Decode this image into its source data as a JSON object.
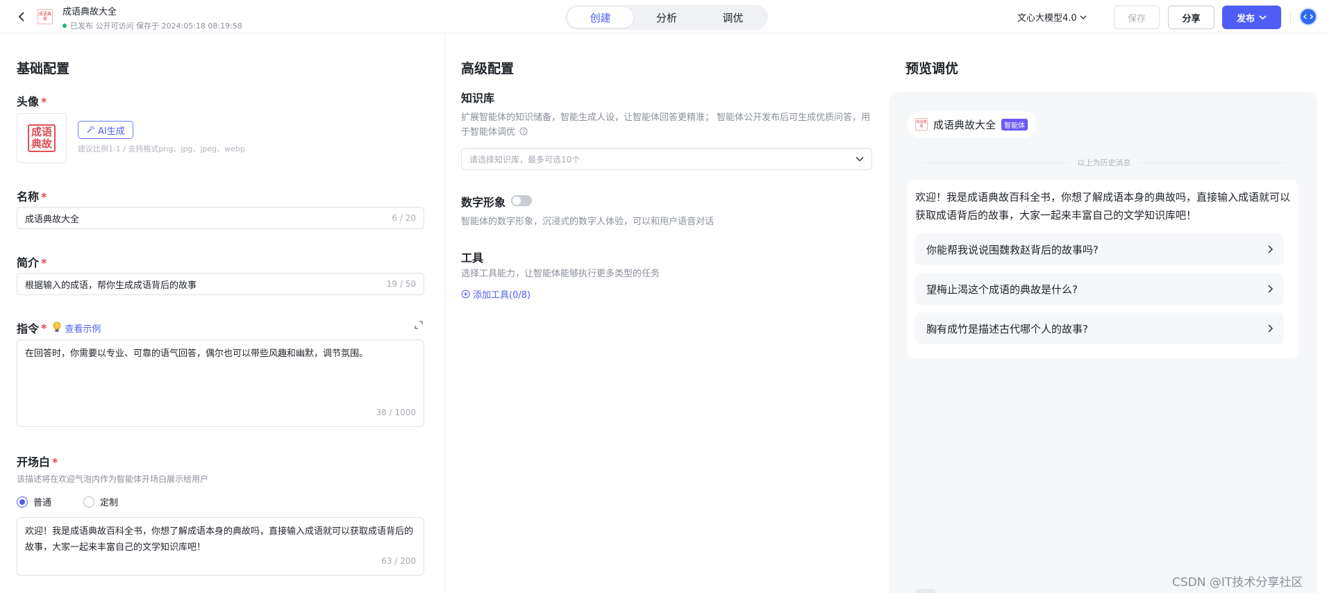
{
  "header": {
    "app_name": "成语典故大全",
    "status": "已发布 公开可访问 保存于 2024:05:18 08:19:58",
    "logo_text": "成语典故",
    "tabs": [
      {
        "label": "创建"
      },
      {
        "label": "分析"
      },
      {
        "label": "调优"
      }
    ],
    "model": "文心大模型4.0",
    "save_label": "保存",
    "share_label": "分享",
    "publish_label": "发布"
  },
  "basic": {
    "title": "基础配置",
    "avatar_label": "头像",
    "seal_text": "成语典故",
    "ai_btn": "AI生成",
    "avatar_hint": "建议比例1:1 / 支持格式png、jpg、jpeg、webp",
    "name_label": "名称",
    "name_value": "成语典故大全",
    "name_count": "6 / 20",
    "intro_label": "简介",
    "intro_value": "根据输入的成语，帮你生成成语背后的故事",
    "intro_count": "19 / 50",
    "instr_label": "指令",
    "instr_link": "查看示例",
    "instr_value": "在回答时，你需要以专业、可靠的语气回答，偶尔也可以带些风趣和幽默，调节氛围。",
    "instr_count": "38 / 1000",
    "opening_label": "开场白",
    "opening_hint": "该描述将在欢迎气泡内作为智能体开场白展示给用户",
    "radio_normal": "普通",
    "radio_custom": "定制",
    "opening_value": "欢迎！我是成语典故百科全书，你想了解成语本身的典故吗，直接输入成语就可以获取成语背后的故事，大家一起来丰富自己的文学知识库吧！",
    "opening_count": "63 / 200"
  },
  "advanced": {
    "title": "高级配置",
    "kb_label": "知识库",
    "kb_hint": "扩展智能体的知识储备，智能生成人设，让智能体回答更精准； 智能体公开发布后可生成优质问答，用于智能体调优",
    "kb_placeholder": "请选择知识库，最多可选10个",
    "avatar_label": "数字形象",
    "avatar_hint": "智能体的数字形象，沉浸式的数字人体验，可以和用户语音对话",
    "tools_label": "工具",
    "tools_hint": "选择工具能力，让智能体能够执行更多类型的任务",
    "add_tool": "添加工具(0/8)"
  },
  "preview": {
    "title": "预览调优",
    "bot_name": "成语典故大全",
    "bot_badge": "智能体",
    "bot_logo_text": "成语典故",
    "history_text": "以上为历史消息",
    "welcome": "欢迎！我是成语典故百科全书，你想了解成语本身的典故吗，直接输入成语就可以获取成语背后的故事，大家一起来丰富自己的文学知识库吧！",
    "questions": [
      {
        "text": "你能帮我说说围魏救赵背后的故事吗?"
      },
      {
        "text": "望梅止渴这个成语的典故是什么?"
      },
      {
        "text": "胸有成竹是描述古代哪个人的故事?"
      }
    ]
  },
  "watermark": "CSDN @IT技术分享社区",
  "colors": {
    "accent": "#4e5ef5",
    "required": "#e5484d",
    "seal": "#e04e56"
  },
  "icons": [
    "back-arrow-icon",
    "chevron-down-icon",
    "magic-wand-icon",
    "lightbulb-icon",
    "expand-icon",
    "help-icon",
    "plus-circle-icon",
    "chevron-right-icon",
    "profile-icon"
  ]
}
